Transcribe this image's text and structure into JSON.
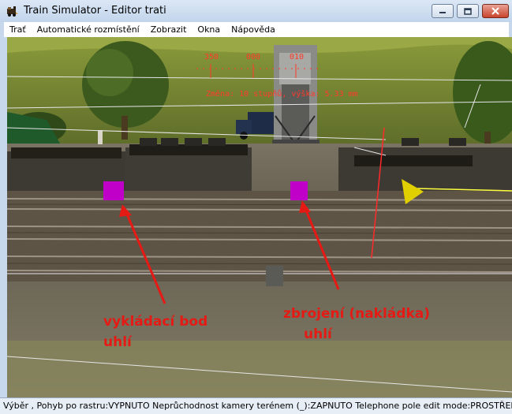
{
  "window": {
    "title": "Train Simulator - Editor trati",
    "controls": {
      "minimize": "minimize",
      "maximize": "maximize",
      "close": "close"
    }
  },
  "menu": {
    "items": [
      "Trať",
      "Automatické rozmístění",
      "Zobrazit",
      "Okna",
      "Nápověda"
    ]
  },
  "scene": {
    "hud": {
      "compass_labels": [
        "350",
        "000",
        "010"
      ],
      "readout": "Změna: 10 stupňů, výška: 5.33 mm"
    },
    "annotations": {
      "left_line1": "vykládací bod",
      "left_line2": "uhlí",
      "right_line1": "zbrojení (nakládka)",
      "right_line2": "uhlí"
    },
    "colors": {
      "annotation": "#e61a14",
      "marker_magenta": "#c000c8",
      "marker_yellow": "#e0d000"
    }
  },
  "status": {
    "text": "Výběr , Pohyb po rastru:VYPNUTO Neprůchodnost kamery terénem (_):ZAPNUTO Telephone pole edit mode:PROSTŘEDN"
  }
}
